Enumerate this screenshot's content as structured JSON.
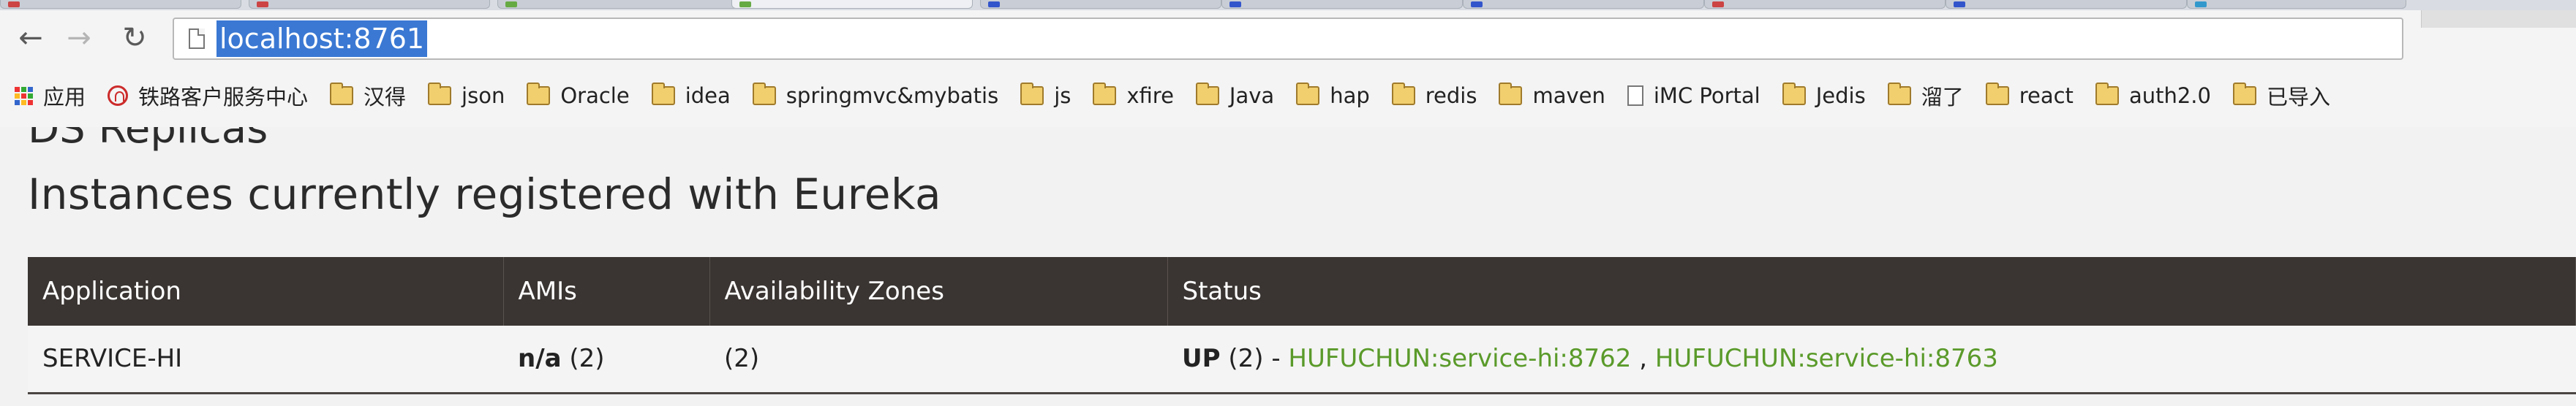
{
  "browser": {
    "url": "localhost:8761",
    "nav": {
      "back_icon": "arrow-left-icon",
      "forward_icon": "arrow-right-icon",
      "reload_icon": "reload-icon"
    },
    "bookmarks": [
      {
        "label": "应用",
        "icon": "apps-icon"
      },
      {
        "label": "铁路客户服务中心",
        "icon": "railway-icon"
      },
      {
        "label": "汉得",
        "icon": "folder-icon"
      },
      {
        "label": "json",
        "icon": "folder-icon"
      },
      {
        "label": "Oracle",
        "icon": "folder-icon"
      },
      {
        "label": "idea",
        "icon": "folder-icon"
      },
      {
        "label": "springmvc&mybatis",
        "icon": "folder-icon"
      },
      {
        "label": "js",
        "icon": "folder-icon"
      },
      {
        "label": "xfire",
        "icon": "folder-icon"
      },
      {
        "label": "Java",
        "icon": "folder-icon"
      },
      {
        "label": "hap",
        "icon": "folder-icon"
      },
      {
        "label": "redis",
        "icon": "folder-icon"
      },
      {
        "label": "maven",
        "icon": "folder-icon"
      },
      {
        "label": "iMC Portal",
        "icon": "document-icon"
      },
      {
        "label": "Jedis",
        "icon": "folder-icon"
      },
      {
        "label": "溜了",
        "icon": "folder-icon"
      },
      {
        "label": "react",
        "icon": "folder-icon"
      },
      {
        "label": "auth2.0",
        "icon": "folder-icon"
      },
      {
        "label": "已导入",
        "icon": "folder-icon"
      }
    ]
  },
  "page": {
    "cut_heading": "DS Replicas",
    "section_title": "Instances currently registered with Eureka",
    "table": {
      "headers": [
        "Application",
        "AMIs",
        "Availability Zones",
        "Status"
      ],
      "rows": [
        {
          "application": "SERVICE-HI",
          "amis_value": "n/a",
          "amis_count": "(2)",
          "zones": "(2)",
          "status_state": "UP",
          "status_count": "(2) -",
          "instance_links": [
            "HUFUCHUN:service-hi:8762",
            "HUFUCHUN:service-hi:8763"
          ],
          "link_separator": ","
        }
      ]
    }
  },
  "colors": {
    "table_header_bg": "#3a3532",
    "link": "#5a9a2a",
    "url_highlight": "#3a78d3"
  }
}
